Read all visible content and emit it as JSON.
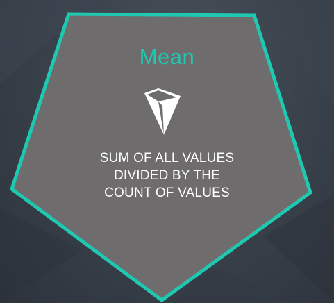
{
  "card": {
    "title": "Mean",
    "description_lines": [
      "SUM OF ALL VALUES",
      "DIVIDED BY THE",
      "COUNT OF VALUES"
    ],
    "icon": "diamond-gem-icon"
  },
  "colors": {
    "background": "#38404a",
    "pentagon_fill": "#6f6c6e",
    "accent": "#1fc8b0",
    "text": "#ffffff"
  }
}
